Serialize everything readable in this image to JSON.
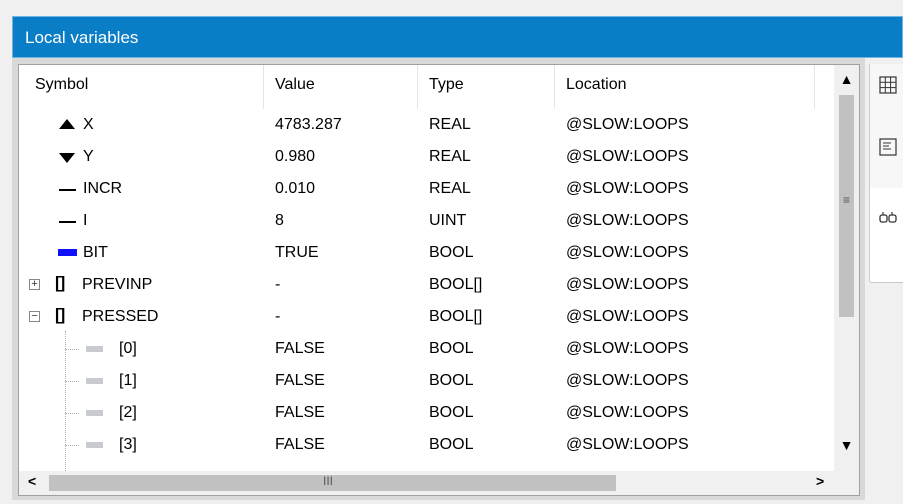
{
  "window": {
    "title": "Local variables"
  },
  "table": {
    "columns": [
      "Symbol",
      "Value",
      "Type",
      "Location"
    ],
    "rows": [
      {
        "symbol": "X",
        "value": "4783.287",
        "type": "REAL",
        "location": "@SLOW:LOOPS"
      },
      {
        "symbol": "Y",
        "value": "0.980",
        "type": "REAL",
        "location": "@SLOW:LOOPS"
      },
      {
        "symbol": "INCR",
        "value": "0.010",
        "type": "REAL",
        "location": "@SLOW:LOOPS"
      },
      {
        "symbol": "I",
        "value": "8",
        "type": "UINT",
        "location": "@SLOW:LOOPS"
      },
      {
        "symbol": "BIT",
        "value": "TRUE",
        "type": "BOOL",
        "location": "@SLOW:LOOPS"
      },
      {
        "symbol": "PREVINP",
        "value": "-",
        "type": "BOOL[]",
        "location": "@SLOW:LOOPS"
      },
      {
        "symbol": "PRESSED",
        "value": "-",
        "type": "BOOL[]",
        "location": "@SLOW:LOOPS"
      },
      {
        "symbol": "[0]",
        "value": "FALSE",
        "type": "BOOL",
        "location": "@SLOW:LOOPS"
      },
      {
        "symbol": "[1]",
        "value": "FALSE",
        "type": "BOOL",
        "location": "@SLOW:LOOPS"
      },
      {
        "symbol": "[2]",
        "value": "FALSE",
        "type": "BOOL",
        "location": "@SLOW:LOOPS"
      },
      {
        "symbol": "[3]",
        "value": "FALSE",
        "type": "BOOL",
        "location": "@SLOW:LOOPS"
      }
    ]
  },
  "markers": {
    "expand": "+",
    "collapse": "−",
    "array_bracket": "[]",
    "scroll_up": "▲",
    "scroll_down": "▼",
    "scroll_left": "<",
    "scroll_right": ">",
    "grip_v": "≡",
    "grip_h": "III"
  },
  "colors": {
    "title_bar": "#0a7dc7",
    "bit_marker": "#1010ff"
  },
  "sidebar": {
    "icons": [
      "grid-icon",
      "list-icon",
      "link-icon"
    ]
  }
}
